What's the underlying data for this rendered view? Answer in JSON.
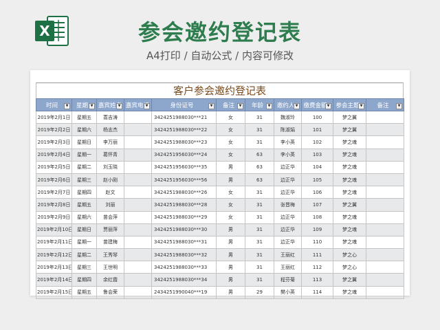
{
  "header": {
    "title": "参会邀约登记表",
    "subtitle": "A4打印 / 自动公式 / 内容可修改",
    "logo_letter": "X"
  },
  "colors": {
    "title_green": "#2e7d4f",
    "header_blue": "#8da6cc",
    "excel_green": "#1e7145"
  },
  "sheet": {
    "title": "客户参会邀约登记表",
    "columns": [
      "时间",
      "星期",
      "嘉宾姓名",
      "嘉宾电话",
      "身份证号",
      "备注",
      "年龄",
      "邀约人",
      "缴费金额",
      "参会主题",
      "备注"
    ],
    "rows": [
      [
        "2019年2月1日",
        "星期五",
        "蒿吉涛",
        "",
        "3424251988030***21",
        "女",
        "31",
        "魏淑玲",
        "100",
        "梦之翼",
        ""
      ],
      [
        "2019年2月2日",
        "星期六",
        "杨志杰",
        "",
        "3424251988030***22",
        "女",
        "31",
        "陈淑娟",
        "101",
        "梦之翼",
        ""
      ],
      [
        "2019年2月3日",
        "星期日",
        "李万丽",
        "",
        "3424251988030***23",
        "女",
        "31",
        "李小英",
        "102",
        "梦之魂",
        ""
      ],
      [
        "2019年2月4日",
        "星期一",
        "葛怀青",
        "",
        "3424251956030***24",
        "女",
        "63",
        "李小英",
        "103",
        "梦之魂",
        ""
      ],
      [
        "2019年2月5日",
        "星期二",
        "刘玉晓",
        "",
        "3424251956030***35",
        "男",
        "63",
        "边正华",
        "104",
        "梦之魂",
        ""
      ],
      [
        "2019年2月6日",
        "星期三",
        "赵小刚",
        "",
        "3424251956030***56",
        "男",
        "63",
        "边正华",
        "105",
        "梦之魂",
        ""
      ],
      [
        "2019年2月7日",
        "星期四",
        "赵文",
        "",
        "3424251988030***26",
        "女",
        "31",
        "边正华",
        "106",
        "梦之魂",
        ""
      ],
      [
        "2019年2月8日",
        "星期五",
        "刘丽",
        "",
        "3424251988030***28",
        "女",
        "31",
        "张晋梅",
        "107",
        "梦之翼",
        ""
      ],
      [
        "2019年2月9日",
        "星期六",
        "苗会萍",
        "",
        "3424251988030***29",
        "女",
        "31",
        "边正华",
        "108",
        "梦之魂",
        ""
      ],
      [
        "2019年2月10日",
        "星期日",
        "贾丽萍",
        "",
        "3424251988030***30",
        "男",
        "31",
        "边正华",
        "109",
        "梦之魂",
        ""
      ],
      [
        "2019年2月11日",
        "星期一",
        "苗建梅",
        "",
        "3424251988030***31",
        "男",
        "31",
        "边正华",
        "110",
        "梦之魂",
        ""
      ],
      [
        "2019年2月12日",
        "星期二",
        "王秀琴",
        "",
        "3424251988030***32",
        "男",
        "31",
        "王丽红",
        "111",
        "梦之心",
        ""
      ],
      [
        "2019年2月13日",
        "星期三",
        "王世明",
        "",
        "3424251988030***33",
        "男",
        "31",
        "王丽红",
        "112",
        "梦之心",
        ""
      ],
      [
        "2019年2月14日",
        "星期四",
        "余红霞",
        "",
        "3424251988030***34",
        "男",
        "31",
        "程芬菊",
        "113",
        "梦之翼",
        ""
      ],
      [
        "2019年2月15日",
        "星期五",
        "鲁会荣",
        "",
        "2434251990040***19",
        "男",
        "29",
        "樊小英",
        "114",
        "梦之魂",
        ""
      ]
    ]
  }
}
